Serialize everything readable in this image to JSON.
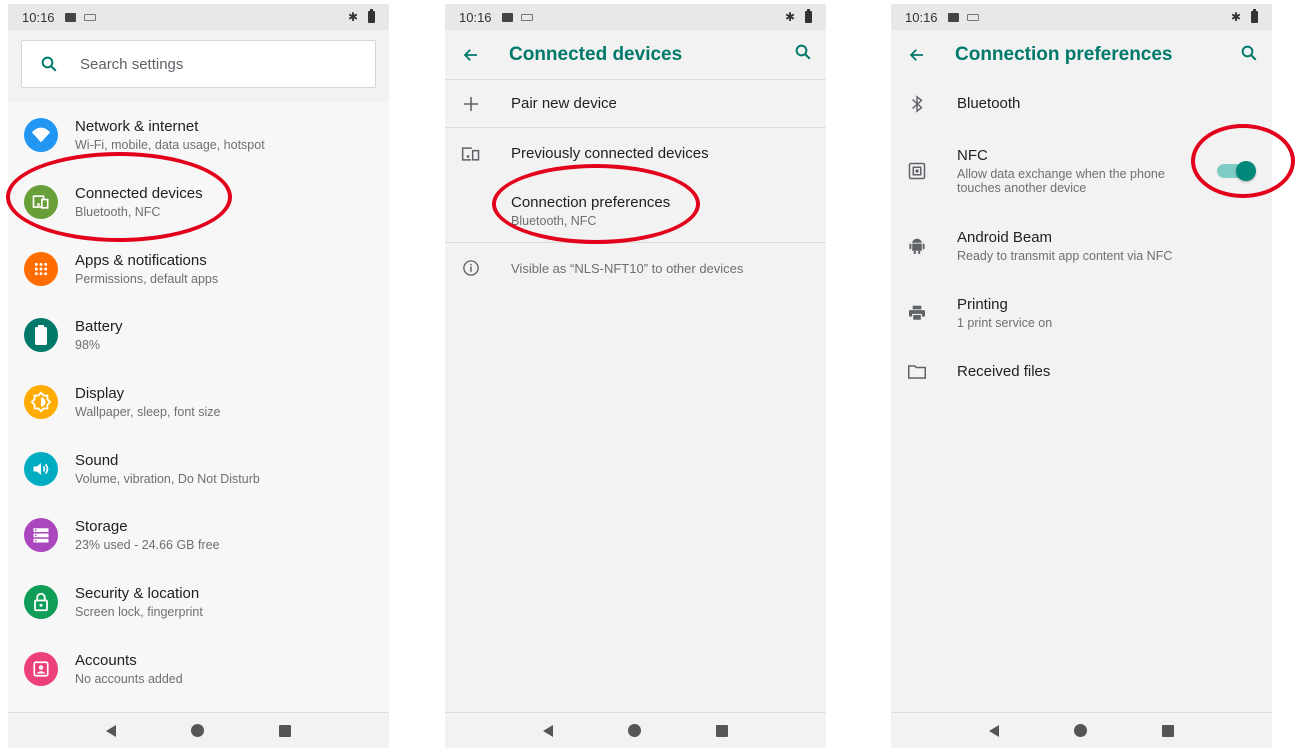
{
  "colors": {
    "accent": "#00796b",
    "annotation": "#e3001b",
    "toggle_on": "#00897b"
  },
  "status_bar": {
    "time": "10:16"
  },
  "panel1": {
    "search": {
      "placeholder": "Search settings",
      "icon": "search-icon"
    },
    "items": [
      {
        "title": "Network & internet",
        "subtitle": "Wi-Fi, mobile, data usage, hotspot",
        "icon": "wifi-icon",
        "color": "#2196f3"
      },
      {
        "title": "Connected devices",
        "subtitle": "Bluetooth, NFC",
        "icon": "devices-icon",
        "color": "#689f38"
      },
      {
        "title": "Apps & notifications",
        "subtitle": "Permissions, default apps",
        "icon": "apps-icon",
        "color": "#ff6d00"
      },
      {
        "title": "Battery",
        "subtitle": "98%",
        "icon": "battery-icon",
        "color": "#00796b"
      },
      {
        "title": "Display",
        "subtitle": "Wallpaper, sleep, font size",
        "icon": "brightness-icon",
        "color": "#ffab00"
      },
      {
        "title": "Sound",
        "subtitle": "Volume, vibration, Do Not Disturb",
        "icon": "volume-icon",
        "color": "#00acc1"
      },
      {
        "title": "Storage",
        "subtitle": "23% used - 24.66 GB free",
        "icon": "storage-icon",
        "color": "#ab47bc"
      },
      {
        "title": "Security & location",
        "subtitle": "Screen lock, fingerprint",
        "icon": "lock-icon",
        "color": "#0f9d58"
      },
      {
        "title": "Accounts",
        "subtitle": "No accounts added",
        "icon": "account-icon",
        "color": "#ec407a"
      }
    ]
  },
  "panel2": {
    "title": "Connected devices",
    "pair": "Pair new device",
    "previous": "Previously connected devices",
    "prefs_title": "Connection preferences",
    "prefs_sub": "Bluetooth, NFC",
    "visible": "Visible as “NLS-NFT10” to other devices"
  },
  "panel3": {
    "title": "Connection preferences",
    "bluetooth": "Bluetooth",
    "nfc_title": "NFC",
    "nfc_sub_line1": "Allow data exchange when the phone",
    "nfc_sub_line2": "touches another device",
    "nfc_enabled": true,
    "beam_title": "Android Beam",
    "beam_sub": "Ready to transmit app content via NFC",
    "printing_title": "Printing",
    "printing_sub": "1 print service on",
    "received": "Received files"
  }
}
